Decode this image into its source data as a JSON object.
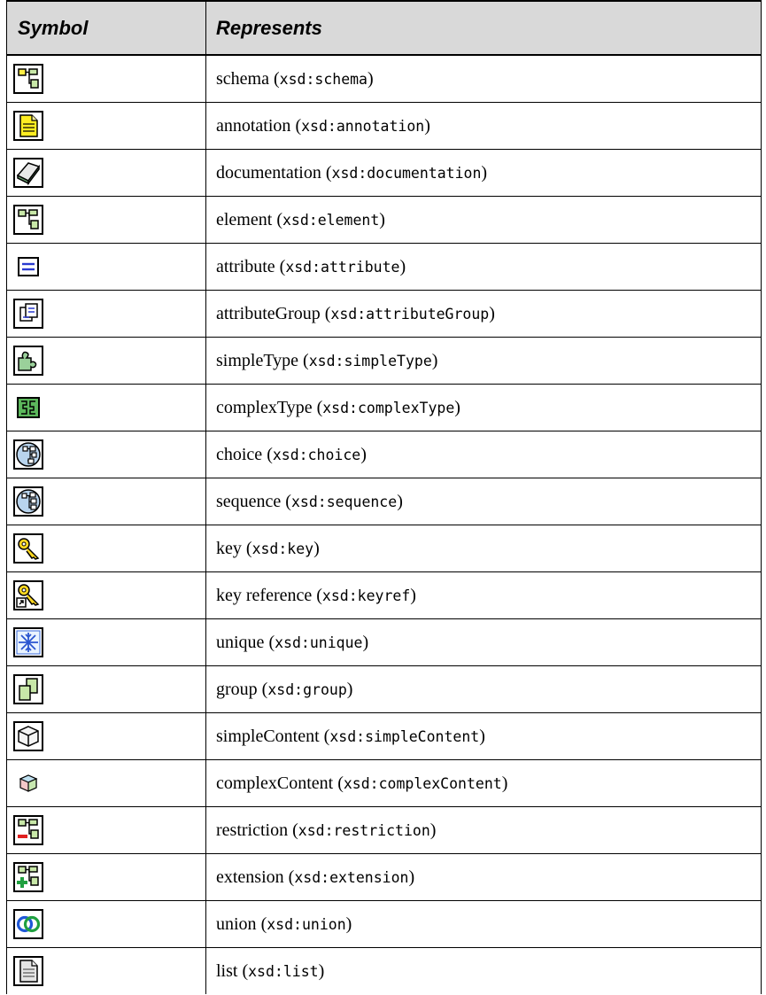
{
  "header": {
    "symbol": "Symbol",
    "represents": "Represents"
  },
  "rows": [
    {
      "icon": "schema-icon",
      "name": "schema",
      "code": "xsd:schema"
    },
    {
      "icon": "annotation-icon",
      "name": "annotation",
      "code": "xsd:annotation"
    },
    {
      "icon": "documentation-icon",
      "name": "documentation",
      "code": "xsd:documentation"
    },
    {
      "icon": "element-icon",
      "name": "element",
      "code": "xsd:element"
    },
    {
      "icon": "attribute-icon",
      "name": "attribute",
      "code": "xsd:attribute"
    },
    {
      "icon": "attribute-group-icon",
      "name": "attributeGroup",
      "code": "xsd:attributeGroup"
    },
    {
      "icon": "simple-type-icon",
      "name": "simpleType",
      "code": "xsd:simpleType"
    },
    {
      "icon": "complex-type-icon",
      "name": "complexType",
      "code": "xsd:complexType"
    },
    {
      "icon": "choice-icon",
      "name": "choice",
      "code": "xsd:choice"
    },
    {
      "icon": "sequence-icon",
      "name": "sequence",
      "code": "xsd:sequence"
    },
    {
      "icon": "key-icon",
      "name": "key",
      "code": "xsd:key"
    },
    {
      "icon": "key-reference-icon",
      "name": "key reference",
      "code": "xsd:keyref"
    },
    {
      "icon": "unique-icon",
      "name": "unique",
      "code": "xsd:unique"
    },
    {
      "icon": "group-icon",
      "name": "group",
      "code": "xsd:group"
    },
    {
      "icon": "simple-content-icon",
      "name": "simpleContent",
      "code": "xsd:simpleContent"
    },
    {
      "icon": "complex-content-icon",
      "name": "complexContent",
      "code": "xsd:complexContent"
    },
    {
      "icon": "restriction-icon",
      "name": "restriction",
      "code": "xsd:restriction"
    },
    {
      "icon": "extension-icon",
      "name": "extension",
      "code": "xsd:extension"
    },
    {
      "icon": "union-icon",
      "name": "union",
      "code": "xsd:union"
    },
    {
      "icon": "list-icon",
      "name": "list",
      "code": "xsd:list"
    }
  ]
}
